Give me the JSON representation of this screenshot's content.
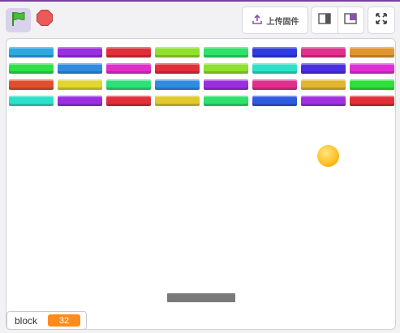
{
  "toolbar": {
    "green_flag_icon": "green-flag-icon",
    "stop_icon": "stop-icon",
    "upload_label": "上传固件",
    "upload_icon": "upload-icon",
    "small_stage_icon": "small-stage-icon",
    "large_stage_icon": "large-stage-icon",
    "fullscreen_icon": "fullscreen-icon"
  },
  "game": {
    "bricks": [
      [
        "#2fa7e0",
        "#9b2fe0",
        "#e02f3a",
        "#8fe02f",
        "#2fe06a",
        "#2f3ae0",
        "#e02f8c",
        "#e0962f"
      ],
      [
        "#2fe04a",
        "#2f8ce0",
        "#e02fc8",
        "#e02f3a",
        "#8fe02f",
        "#2fe0c8",
        "#4a2fe0",
        "#e02fd6"
      ],
      [
        "#e0502f",
        "#e0d62f",
        "#2fe07a",
        "#2f8ce0",
        "#9b2fe0",
        "#e02f8c",
        "#e0b62f",
        "#2fe03a"
      ],
      [
        "#2fe0c8",
        "#9b2fe0",
        "#e02f3a",
        "#e0c82f",
        "#2fe06a",
        "#2f5ae0",
        "#a02fe0",
        "#e02f3a"
      ]
    ],
    "ball_color": "#ffc22a",
    "paddle_color": "#7a7a7a"
  },
  "monitor": {
    "label": "block",
    "value": "32",
    "value_color": "#ff8c1a"
  }
}
